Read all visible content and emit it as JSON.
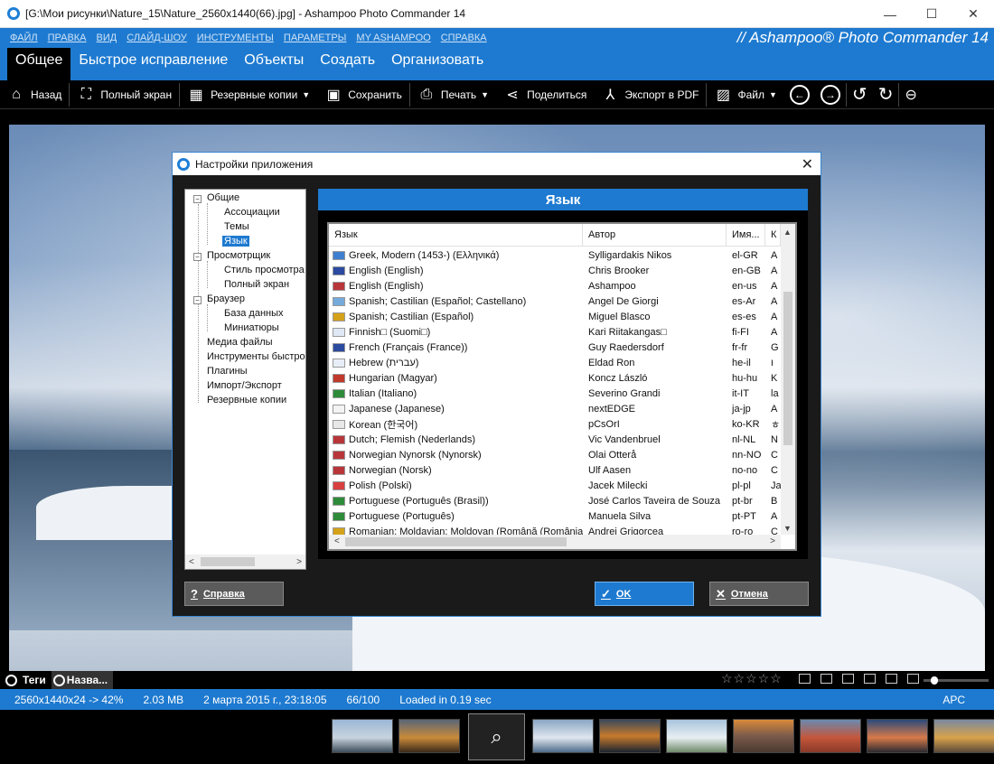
{
  "window": {
    "title": "[G:\\Мои рисунки\\Nature_15\\Nature_2560x1440(66).jpg] - Ashampoo Photo Commander 14",
    "minimize": "—",
    "maximize": "☐",
    "close": "✕"
  },
  "menu": {
    "items": [
      "ФАЙЛ",
      "ПРАВКА",
      "ВИД",
      "СЛАЙД-ШОУ",
      "ИНСТРУМЕНТЫ",
      "ПАРАМЕТРЫ",
      "MY ASHAMPOO",
      "СПРАВКА"
    ],
    "brand": "// Ashampoo® Photo Commander 14"
  },
  "tabs": [
    "Общее",
    "Быстрое исправление",
    "Объекты",
    "Создать",
    "Организовать"
  ],
  "toolbar": {
    "back": "Назад",
    "fullscreen": "Полный экран",
    "backups": "Резервные копии",
    "save": "Сохранить",
    "print": "Печать",
    "share": "Поделиться",
    "export_pdf": "Экспорт в PDF",
    "file": "Файл"
  },
  "dialog": {
    "title": "Настройки приложения",
    "close": "✕",
    "tree": [
      {
        "label": "Общие",
        "level": 0,
        "expander": "−"
      },
      {
        "label": "Ассоциации",
        "level": 1
      },
      {
        "label": "Темы",
        "level": 1
      },
      {
        "label": "Язык",
        "level": 1,
        "selected": true
      },
      {
        "label": "Просмотрщик",
        "level": 0,
        "expander": "−"
      },
      {
        "label": "Стиль просмотра",
        "level": 1
      },
      {
        "label": "Полный экран",
        "level": 1
      },
      {
        "label": "Браузер",
        "level": 0,
        "expander": "−"
      },
      {
        "label": "База данных",
        "level": 1
      },
      {
        "label": "Миниатюры",
        "level": 1
      },
      {
        "label": "Медиа файлы",
        "level": 0
      },
      {
        "label": "Инструменты быстро",
        "level": 0
      },
      {
        "label": "Плагины",
        "level": 0
      },
      {
        "label": "Импорт/Экспорт",
        "level": 0
      },
      {
        "label": "Резервные копии",
        "level": 0
      }
    ],
    "panel_title": "Язык",
    "columns": [
      "Язык",
      "Автор",
      "Имя...",
      "К"
    ],
    "rows": [
      {
        "lang": "Greek, Modern (1453-) (Ελληνικά)",
        "author": "Sylligardakis Nikos",
        "code": "el-GR",
        "k": "A",
        "flag": "#3f7fd0"
      },
      {
        "lang": "English (English)",
        "author": "Chris Brooker",
        "code": "en-GB",
        "k": "A",
        "flag": "#2b4aa0"
      },
      {
        "lang": "English (English)",
        "author": "Ashampoo",
        "code": "en-us",
        "k": "A",
        "flag": "#b8363a"
      },
      {
        "lang": "Spanish; Castilian (Español; Castellano)",
        "author": "Angel De Giorgi",
        "code": "es-Ar",
        "k": "A",
        "flag": "#75aadb"
      },
      {
        "lang": "Spanish; Castilian (Español)",
        "author": "Miguel Blasco",
        "code": "es-es",
        "k": "A",
        "flag": "#d4a21a"
      },
      {
        "lang": "Finnish□ (Suomi□)",
        "author": "Kari Riitakangas□",
        "code": "fi-FI",
        "k": "A",
        "flag": "#dfe8f5"
      },
      {
        "lang": "French (Français (France))",
        "author": "Guy Raedersdorf",
        "code": "fr-fr",
        "k": "G",
        "flag": "#2b4aa0"
      },
      {
        "lang": "Hebrew (עברית)",
        "author": "Eldad Ron",
        "code": "he-il",
        "k": "ו",
        "flag": "#e8eef8"
      },
      {
        "lang": "Hungarian (Magyar)",
        "author": "Koncz László",
        "code": "hu-hu",
        "k": "K",
        "flag": "#c0392b"
      },
      {
        "lang": "Italian (Italiano)",
        "author": "Severino Grandi",
        "code": "it-IT",
        "k": "la",
        "flag": "#2e8b3a"
      },
      {
        "lang": "Japanese (Japanese)",
        "author": "nextEDGE",
        "code": "ja-jp",
        "k": "A",
        "flag": "#f3f3f3"
      },
      {
        "lang": "Korean (한국어)",
        "author": "pCsOrI",
        "code": "ko-KR",
        "k": "ㅎ",
        "flag": "#e8e8e8"
      },
      {
        "lang": "Dutch; Flemish (Nederlands)",
        "author": "Vic Vandenbruel",
        "code": "nl-NL",
        "k": "N",
        "flag": "#b8363a"
      },
      {
        "lang": "Norwegian Nynorsk (Nynorsk)",
        "author": "Olai Otterå",
        "code": "nn-NO",
        "k": "C",
        "flag": "#b8363a"
      },
      {
        "lang": "Norwegian (Norsk)",
        "author": "Ulf Aasen",
        "code": "no-no",
        "k": "C",
        "flag": "#b8363a"
      },
      {
        "lang": "Polish (Polski)",
        "author": "Jacek Milecki",
        "code": "pl-pl",
        "k": "Ja",
        "flag": "#d84040"
      },
      {
        "lang": "Portuguese (Português (Brasil))",
        "author": "José Carlos Taveira de Souza",
        "code": "pt-br",
        "k": "B",
        "flag": "#2e8b3a"
      },
      {
        "lang": "Portuguese (Português)",
        "author": "Manuela Silva",
        "code": "pt-PT",
        "k": "A",
        "flag": "#2e8b3a"
      },
      {
        "lang": "Romanian; Moldavian; Moldovan (Română (România))",
        "author": "Andrei Grigorcea",
        "code": "ro-ro",
        "k": "C",
        "flag": "#d4a21a"
      }
    ],
    "buttons": {
      "help": "Справка",
      "ok": "OK",
      "cancel": "Отмена"
    }
  },
  "bottombar": {
    "tab1": "Теги",
    "tab2": "Назва...",
    "stars": "☆☆☆☆☆"
  },
  "status": {
    "dims": "2560x1440x24 -> 42%",
    "size": "2.03 MB",
    "date": "2 марта 2015 г., 23:18:05",
    "index": "66/100",
    "loaded": "Loaded in 0.19 sec",
    "kb": "APC"
  }
}
